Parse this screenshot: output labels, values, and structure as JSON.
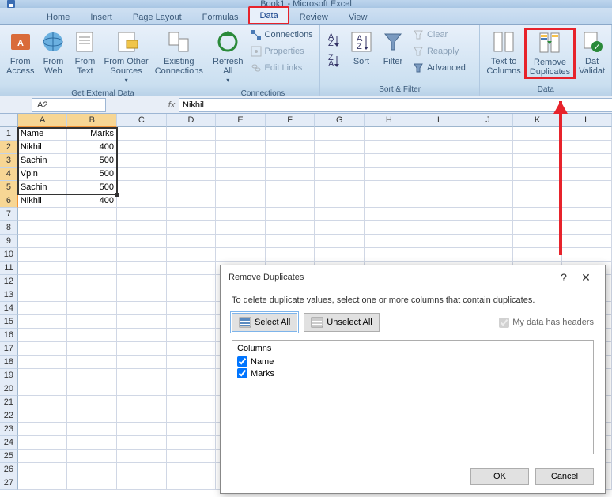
{
  "title": "Book1 - Microsoft Excel",
  "tabs": [
    "Home",
    "Insert",
    "Page Layout",
    "Formulas",
    "Data",
    "Review",
    "View"
  ],
  "active_tab": 4,
  "ribbon": {
    "get_external": {
      "label": "Get External Data",
      "btns": [
        "From\nAccess",
        "From\nWeb",
        "From\nText",
        "From Other\nSources",
        "Existing\nConnections"
      ]
    },
    "connections": {
      "label": "Connections",
      "refresh": "Refresh\nAll",
      "items": [
        "Connections",
        "Properties",
        "Edit Links"
      ]
    },
    "sort_filter": {
      "label": "Sort & Filter",
      "sort": "Sort",
      "filter": "Filter",
      "clear": "Clear",
      "reapply": "Reapply",
      "advanced": "Advanced"
    },
    "data_tools": {
      "label": "Data",
      "txtcol": "Text to\nColumns",
      "remdup": "Remove\nDuplicates",
      "valid": "Dat\nValidat"
    }
  },
  "namebox": "A2",
  "formula": "Nikhil",
  "cols": [
    "A",
    "B",
    "C",
    "D",
    "E",
    "F",
    "G",
    "H",
    "I",
    "J",
    "K",
    "L"
  ],
  "data_rows": [
    {
      "r": 1,
      "a": "Name",
      "b": "Marks"
    },
    {
      "r": 2,
      "a": "Nikhil",
      "b": "400"
    },
    {
      "r": 3,
      "a": "Sachin",
      "b": "500"
    },
    {
      "r": 4,
      "a": "Vpin",
      "b": "500"
    },
    {
      "r": 5,
      "a": "Sachin",
      "b": "500"
    },
    {
      "r": 6,
      "a": "Nikhil",
      "b": "400"
    }
  ],
  "dialog": {
    "title": "Remove Duplicates",
    "text": "To delete duplicate values, select one or more columns that contain duplicates.",
    "select_all": "Select All",
    "unselect_all": "Unselect All",
    "headers_chk": "My data has headers",
    "cols_hdr": "Columns",
    "cols": [
      "Name",
      "Marks"
    ],
    "ok": "OK",
    "cancel": "Cancel"
  }
}
